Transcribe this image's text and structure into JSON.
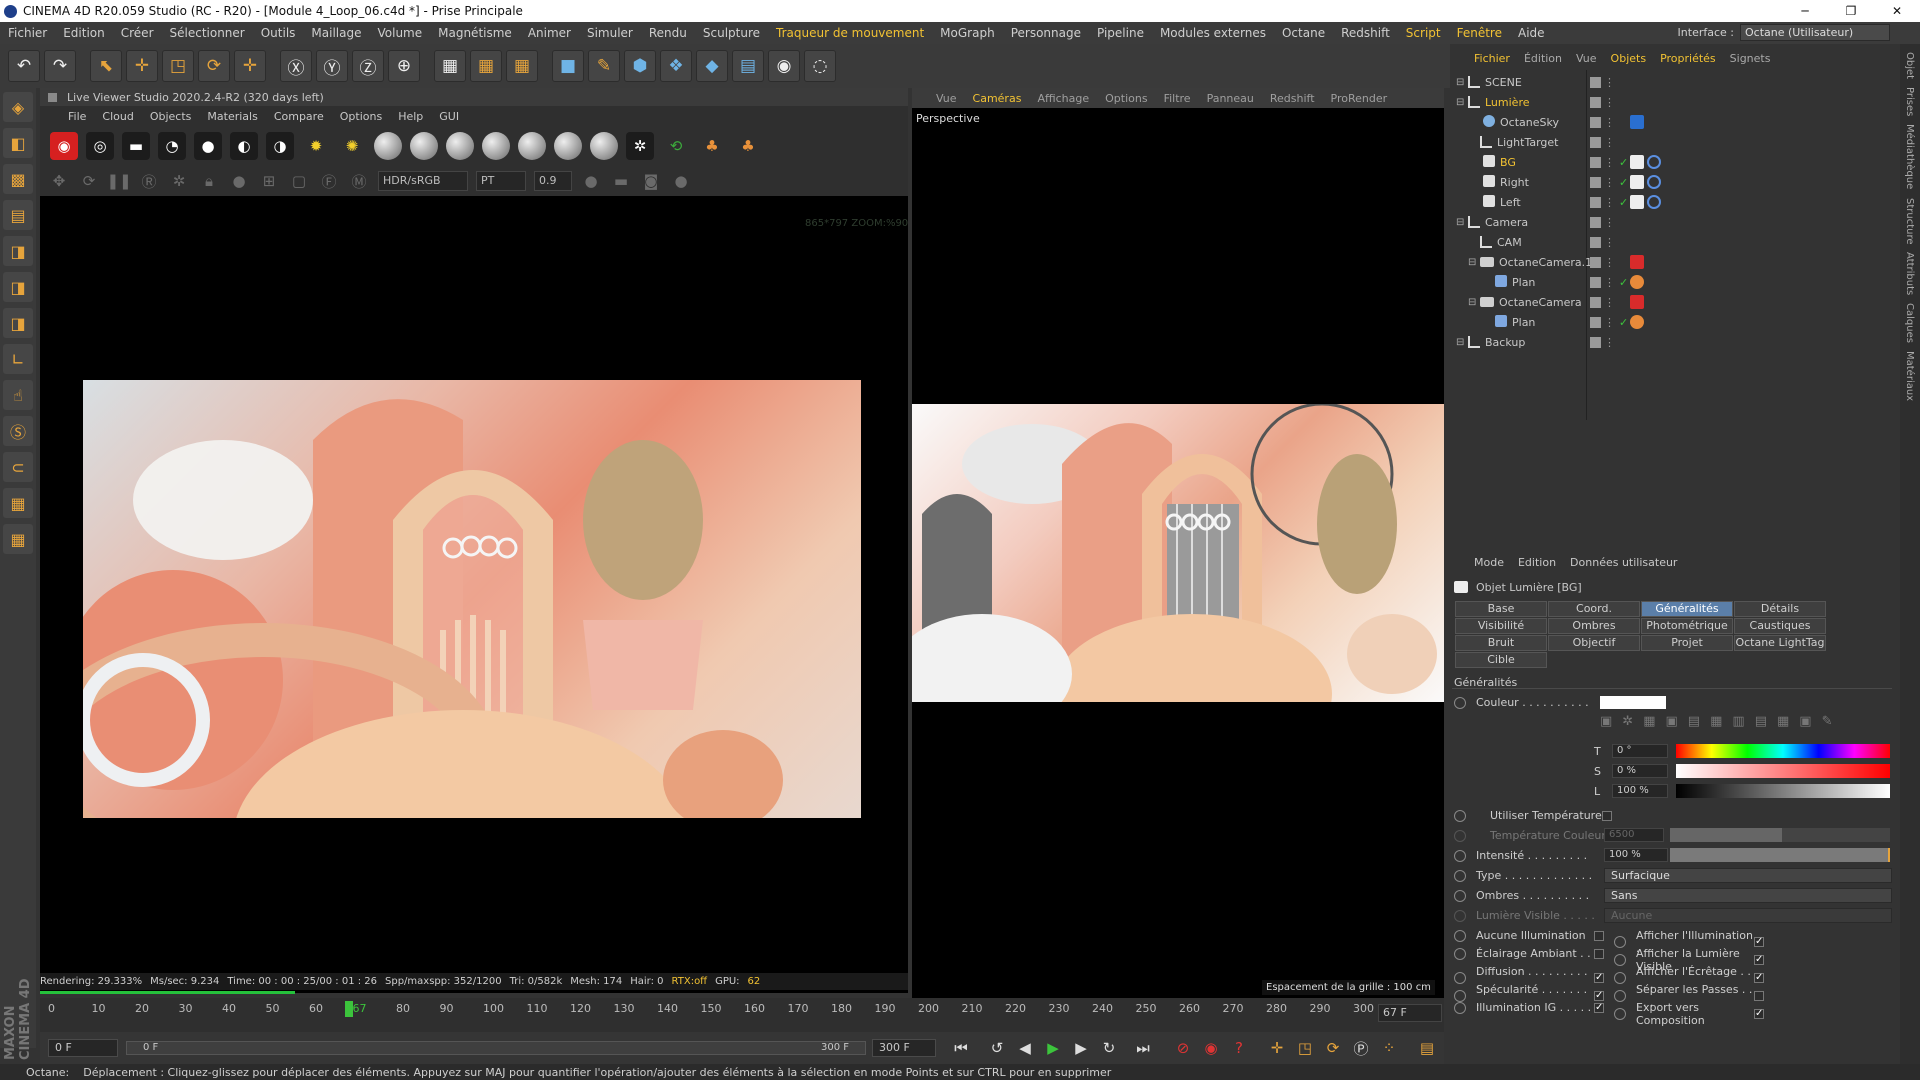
{
  "window": {
    "title": "CINEMA 4D R20.059 Studio (RC - R20) - [Module 4_Loop_06.c4d *] - Prise Principale",
    "minimize": "─",
    "maximize": "❐",
    "close": "✕"
  },
  "menubar": [
    {
      "label": "Fichier"
    },
    {
      "label": "Edition"
    },
    {
      "label": "Créer"
    },
    {
      "label": "Sélectionner"
    },
    {
      "label": "Outils"
    },
    {
      "label": "Maillage"
    },
    {
      "label": "Volume"
    },
    {
      "label": "Magnétisme"
    },
    {
      "label": "Animer"
    },
    {
      "label": "Simuler"
    },
    {
      "label": "Rendu"
    },
    {
      "label": "Sculpture"
    },
    {
      "label": "Traqueur de mouvement",
      "hl": true
    },
    {
      "label": "MoGraph"
    },
    {
      "label": "Personnage"
    },
    {
      "label": "Pipeline"
    },
    {
      "label": "Modules externes"
    },
    {
      "label": "Octane"
    },
    {
      "label": "Redshift"
    },
    {
      "label": "Script",
      "hl": true
    },
    {
      "label": "Fenêtre",
      "hl": true
    },
    {
      "label": "Aide"
    }
  ],
  "interface": {
    "label": "Interface :",
    "value": "Octane (Utilisateur)"
  },
  "live_viewer": {
    "title": "Live Viewer Studio 2020.2.4-R2 (320 days left)",
    "menu": [
      "File",
      "Cloud",
      "Objects",
      "Materials",
      "Compare",
      "Options",
      "Help",
      "GUI"
    ],
    "color_mode": "HDR/sRGB",
    "kernel": "PT",
    "exposure": "0.9",
    "zoom_readout": "865*797 ZOOM:%90",
    "status": {
      "rendering": "Rendering: 29.333%",
      "mssec": "Ms/sec: 9.234",
      "time": "Time: 00 : 00 : 25/00 : 01 : 26",
      "spp": "Spp/maxspp: 352/1200",
      "tri": "Tri: 0/582k",
      "mesh": "Mesh: 174",
      "hair": "Hair: 0",
      "rtx": "RTX:off",
      "gpu": "GPU:",
      "gpu_val": "62"
    },
    "progress": 0.29333
  },
  "viewport": {
    "menu": [
      {
        "label": "Vue"
      },
      {
        "label": "Caméras",
        "hl": true
      },
      {
        "label": "Affichage"
      },
      {
        "label": "Options"
      },
      {
        "label": "Filtre"
      },
      {
        "label": "Panneau"
      },
      {
        "label": "Redshift"
      },
      {
        "label": "ProRender"
      }
    ],
    "label": "Perspective",
    "grid": "Espacement de la grille : 100 cm"
  },
  "timeline": {
    "ticks": [
      "0",
      "10",
      "20",
      "30",
      "40",
      "50",
      "60",
      "67",
      "80",
      "90",
      "100",
      "110",
      "120",
      "130",
      "140",
      "150",
      "160",
      "170",
      "180",
      "190",
      "200",
      "210",
      "220",
      "230",
      "240",
      "250",
      "260",
      "270",
      "280",
      "290",
      "300"
    ],
    "current": "67",
    "end_field": "67 F",
    "start": "0 F",
    "range_start": "0 F",
    "range_end": "300 F",
    "end": "300 F"
  },
  "statusbar": {
    "app": "Octane:",
    "message": "Déplacement : Cliquez-glissez pour déplacer des éléments. Appuyez sur MAJ pour quantifier l'opération/ajouter des éléments à la sélection en mode Points et sur CTRL pour en supprimer"
  },
  "objects_panel": {
    "tabs": [
      {
        "label": "Fichier",
        "hl": true
      },
      {
        "label": "Édition"
      },
      {
        "label": "Vue"
      },
      {
        "label": "Objets",
        "hl": true
      },
      {
        "label": "Propriétés",
        "hl": true
      },
      {
        "label": "Signets"
      }
    ],
    "rows": [
      {
        "name": "SCENE",
        "kind": "null",
        "depth": 0
      },
      {
        "name": "Lumière",
        "kind": "null",
        "depth": 0,
        "hl": true
      },
      {
        "name": "OctaneSky",
        "kind": "sky",
        "depth": 1
      },
      {
        "name": "LightTarget",
        "kind": "null",
        "depth": 1
      },
      {
        "name": "BG",
        "kind": "light",
        "depth": 1,
        "hl": true
      },
      {
        "name": "Right",
        "kind": "light",
        "depth": 1
      },
      {
        "name": "Left",
        "kind": "light",
        "depth": 1
      },
      {
        "name": "Camera",
        "kind": "null",
        "depth": 0
      },
      {
        "name": "CAM",
        "kind": "null",
        "depth": 1
      },
      {
        "name": "OctaneCamera.1",
        "kind": "cam",
        "depth": 1
      },
      {
        "name": "Plan",
        "kind": "plane",
        "depth": 2
      },
      {
        "name": "OctaneCamera",
        "kind": "cam",
        "depth": 1
      },
      {
        "name": "Plan",
        "kind": "plane",
        "depth": 2
      },
      {
        "name": "Backup",
        "kind": "null",
        "depth": 0
      }
    ]
  },
  "side_tabs": [
    "Objet",
    "Prises",
    "Médiathèque",
    "Structure",
    "Attributs",
    "Calques",
    "Matériaux"
  ],
  "attributes": {
    "head": [
      "Mode",
      "Edition",
      "Données utilisateur"
    ],
    "title": "Objet Lumière [BG]",
    "tabs": [
      {
        "label": "Base"
      },
      {
        "label": "Coord."
      },
      {
        "label": "Généralités",
        "on": true
      },
      {
        "label": "Détails"
      },
      {
        "label": "Visibilité"
      },
      {
        "label": "Ombres"
      },
      {
        "label": "Photométrique"
      },
      {
        "label": "Caustiques"
      },
      {
        "label": "Bruit"
      },
      {
        "label": "Objectif"
      },
      {
        "label": "Projet"
      },
      {
        "label": "Octane LightTag"
      },
      {
        "label": "Cible"
      }
    ],
    "section": "Généralités",
    "couleur": "Couleur . . . . . . . . . .",
    "T": {
      "label": "T",
      "value": "0 °"
    },
    "S": {
      "label": "S",
      "value": "0 %"
    },
    "L": {
      "label": "L",
      "value": "100 %"
    },
    "use_temp": "Utiliser Température",
    "temp": {
      "label": "Température Couleur",
      "value": "6500"
    },
    "intensity": {
      "label": "Intensité . . . . . . . . .",
      "value": "100 %"
    },
    "type": {
      "label": "Type . . . . . . . . . . . . .",
      "value": "Surfacique"
    },
    "ombres": {
      "label": "Ombres . . . . . . . . . .",
      "value": "Sans"
    },
    "visible": {
      "label": "Lumière Visible . . . . .",
      "value": "Aucune"
    },
    "checks_left": [
      {
        "label": "Aucune Illumination",
        "checked": false
      },
      {
        "label": "Éclairage Ambiant . .",
        "checked": false
      },
      {
        "label": "Diffusion . . . . . . . . . .",
        "checked": true
      },
      {
        "label": "Spécularité . . . . . . . .",
        "checked": true
      },
      {
        "label": "Illumination IG . . . . .",
        "checked": true
      }
    ],
    "checks_right": [
      {
        "label": "Afficher l'Illumination . . .",
        "checked": true
      },
      {
        "label": "Afficher la Lumière Visible",
        "checked": true
      },
      {
        "label": "Afficher l'Écrêtage . . . . .",
        "checked": true
      },
      {
        "label": "Séparer les Passes . . . . .",
        "checked": false
      },
      {
        "label": "Export vers Composition",
        "checked": true
      }
    ],
    "checkmark": "✓"
  },
  "brand": "MAXON CINEMA 4D"
}
